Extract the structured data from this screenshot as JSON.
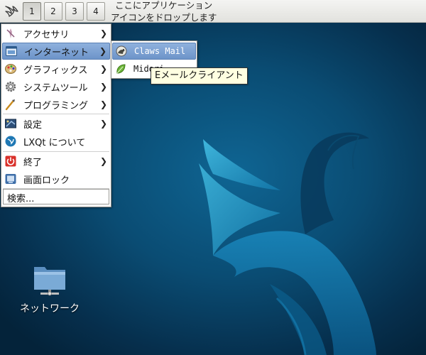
{
  "panel": {
    "desktops": [
      "1",
      "2",
      "3",
      "4"
    ],
    "active_desktop": 0,
    "quicklaunch_hint_line1": "ここにアプリケーション",
    "quicklaunch_hint_line2": "アイコンをドロップします",
    "start_icon": "lxqt-bird-logo"
  },
  "main_menu": {
    "items": [
      {
        "label": "アクセサリ",
        "icon": "accessories-icon",
        "submenu": true
      },
      {
        "label": "インターネット",
        "icon": "internet-icon",
        "submenu": true,
        "highlighted": true
      },
      {
        "label": "グラフィックス",
        "icon": "graphics-palette-icon",
        "submenu": true
      },
      {
        "label": "システムツール",
        "icon": "system-gear-icon",
        "submenu": true
      },
      {
        "label": "プログラミング",
        "icon": "programming-brush-icon",
        "submenu": true
      },
      {
        "label": "設定",
        "icon": "settings-icon",
        "submenu": true
      },
      {
        "label": "LXQt について",
        "icon": "lxqt-logo-icon",
        "submenu": false
      },
      {
        "label": "終了",
        "icon": "power-icon",
        "submenu": true
      },
      {
        "label": "画面ロック",
        "icon": "lock-screen-icon",
        "submenu": false
      }
    ],
    "search_label": "検索...",
    "arrow": "❯"
  },
  "internet_submenu": {
    "items": [
      {
        "label": "Claws Mail",
        "icon": "claws-mail-icon",
        "highlighted": true
      },
      {
        "label": "Midori",
        "icon": "midori-leaf-icon",
        "highlighted": false
      }
    ]
  },
  "tooltip": {
    "text": "Eメールクライアント"
  },
  "desktop": {
    "network_label": "ネットワーク",
    "network_icon": "network-folder-icon"
  },
  "colors": {
    "highlight": "#6d94c9",
    "desktop_dark": "#062f4d",
    "desktop_mid": "#0f6593",
    "tooltip_bg": "#ffffe1"
  }
}
